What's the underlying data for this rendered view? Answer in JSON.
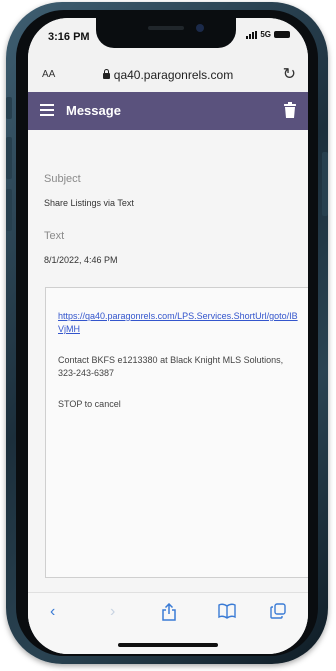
{
  "status_bar": {
    "time": "3:16 PM",
    "network": "5G"
  },
  "browser": {
    "text_size_label": "AA",
    "url": "qa40.paragonrels.com"
  },
  "app_header": {
    "title": "Message"
  },
  "message": {
    "subject_label": "Subject",
    "subject_value": "Share Listings via Text",
    "text_label": "Text",
    "text_date": "8/1/2022, 4:46 PM",
    "link": "https://qa40.paragonrels.com/LPS.Services.ShortUrl/goto/IBVjMH",
    "contact": "Contact BKFS e1213380 at Black Knight MLS Solutions, 323-243-6387",
    "stop": "STOP to cancel"
  },
  "colors": {
    "header_bg": "#5a527d",
    "link": "#3355cc",
    "toolbar_icon": "#3a7bd5"
  },
  "toolbar_icons": [
    "back-icon",
    "forward-icon",
    "share-icon",
    "bookmarks-icon",
    "tabs-icon"
  ]
}
